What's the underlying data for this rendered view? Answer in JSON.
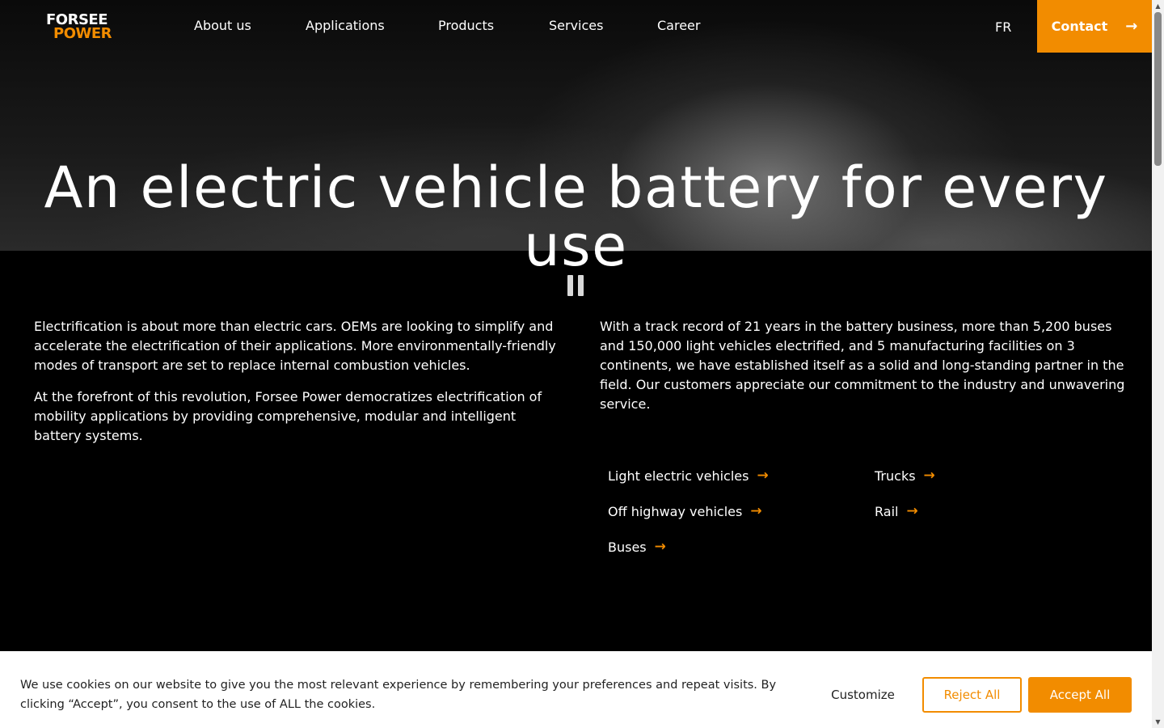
{
  "brand": {
    "logo_line1": "FORSEE",
    "logo_line2": "POWER",
    "accent_color": "#f28c00"
  },
  "nav": {
    "items": [
      {
        "label": "About us"
      },
      {
        "label": "Applications"
      },
      {
        "label": "Products"
      },
      {
        "label": "Services"
      },
      {
        "label": "Career"
      }
    ],
    "language": "FR",
    "contact_label": "Contact",
    "contact_icon": "arrow-right-icon"
  },
  "hero": {
    "title": "An electric vehicle battery for every use",
    "pause_icon": "pause-icon"
  },
  "intro": {
    "left_p1": "Electrification is about more than electric cars. OEMs are looking to simplify and accelerate the electrification of their applications. More environmentally-friendly modes of transport are set to replace internal combustion vehicles.",
    "left_p2": "At the forefront of this revolution, Forsee Power democratizes electrification of mobility applications by providing comprehensive, modular and intelligent battery systems.",
    "right_p1": "With a track record of 21 years in the battery business, more than 5,200 buses and 150,000 light vehicles electrified, and 5 manufacturing facilities on 3 continents, we have established itself as a solid and long-standing partner in the field. Our customers appreciate our commitment to the industry and unwavering service."
  },
  "applications": [
    {
      "label": "Light electric vehicles"
    },
    {
      "label": "Trucks"
    },
    {
      "label": "Off highway vehicles"
    },
    {
      "label": "Rail"
    },
    {
      "label": "Buses"
    }
  ],
  "cookie": {
    "text": "We use cookies on our website to give you the most relevant experience by remembering your preferences and repeat visits. By clicking “Accept”, you consent to the use of ALL the cookies.",
    "customize": "Customize",
    "reject": "Reject All",
    "accept": "Accept All"
  }
}
